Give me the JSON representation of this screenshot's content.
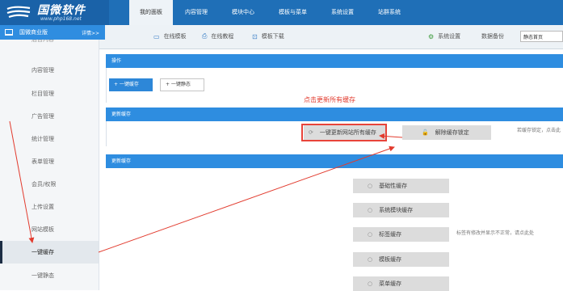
{
  "brand": {
    "title": "国微软件",
    "url": "www.php168.net"
  },
  "nav": {
    "items": [
      "我的面板",
      "内容管理",
      "模块中心",
      "模板与菜单",
      "系统设置",
      "站群系统"
    ],
    "active_index": 0
  },
  "sidebar": {
    "header": "国微商业版",
    "more": "详情>>",
    "items": [
      "后台内容",
      "内容管理",
      "栏目管理",
      "广告管理",
      "统计管理",
      "表单管理",
      "会员/权限",
      "上传设置",
      "网站模板",
      "一键缓存",
      "一键静态"
    ],
    "active_item": "一键缓存"
  },
  "subbar": {
    "links": [
      "在线模板",
      "在线教程",
      "模板下载"
    ],
    "right_links": [
      "系统设置",
      "数据备份"
    ],
    "static_select": "静态首页"
  },
  "ops": {
    "title": "操作",
    "cache_button": "+ 一键缓存",
    "static_button": "+ 一键静态"
  },
  "update": {
    "title": "更新缓存",
    "update_all": "一键更新网站所有缓存",
    "unlock": "解除缓存锁定",
    "note": "若缓存锁定，点击此"
  },
  "update2": {
    "title": "更新缓存",
    "buttons": [
      "基础性缓存",
      "系统模块缓存",
      "标签缓存",
      "模板缓存",
      "菜单缓存"
    ],
    "tag_note": "标签有修改并显示不正常，请点此处"
  },
  "annotation": {
    "text": "点击更新所有缓存",
    "color": "#e23b2e"
  },
  "colors": {
    "topbar": "#1f6fb7",
    "section_header": "#2e8de0",
    "annotation": "#e23b2e"
  }
}
